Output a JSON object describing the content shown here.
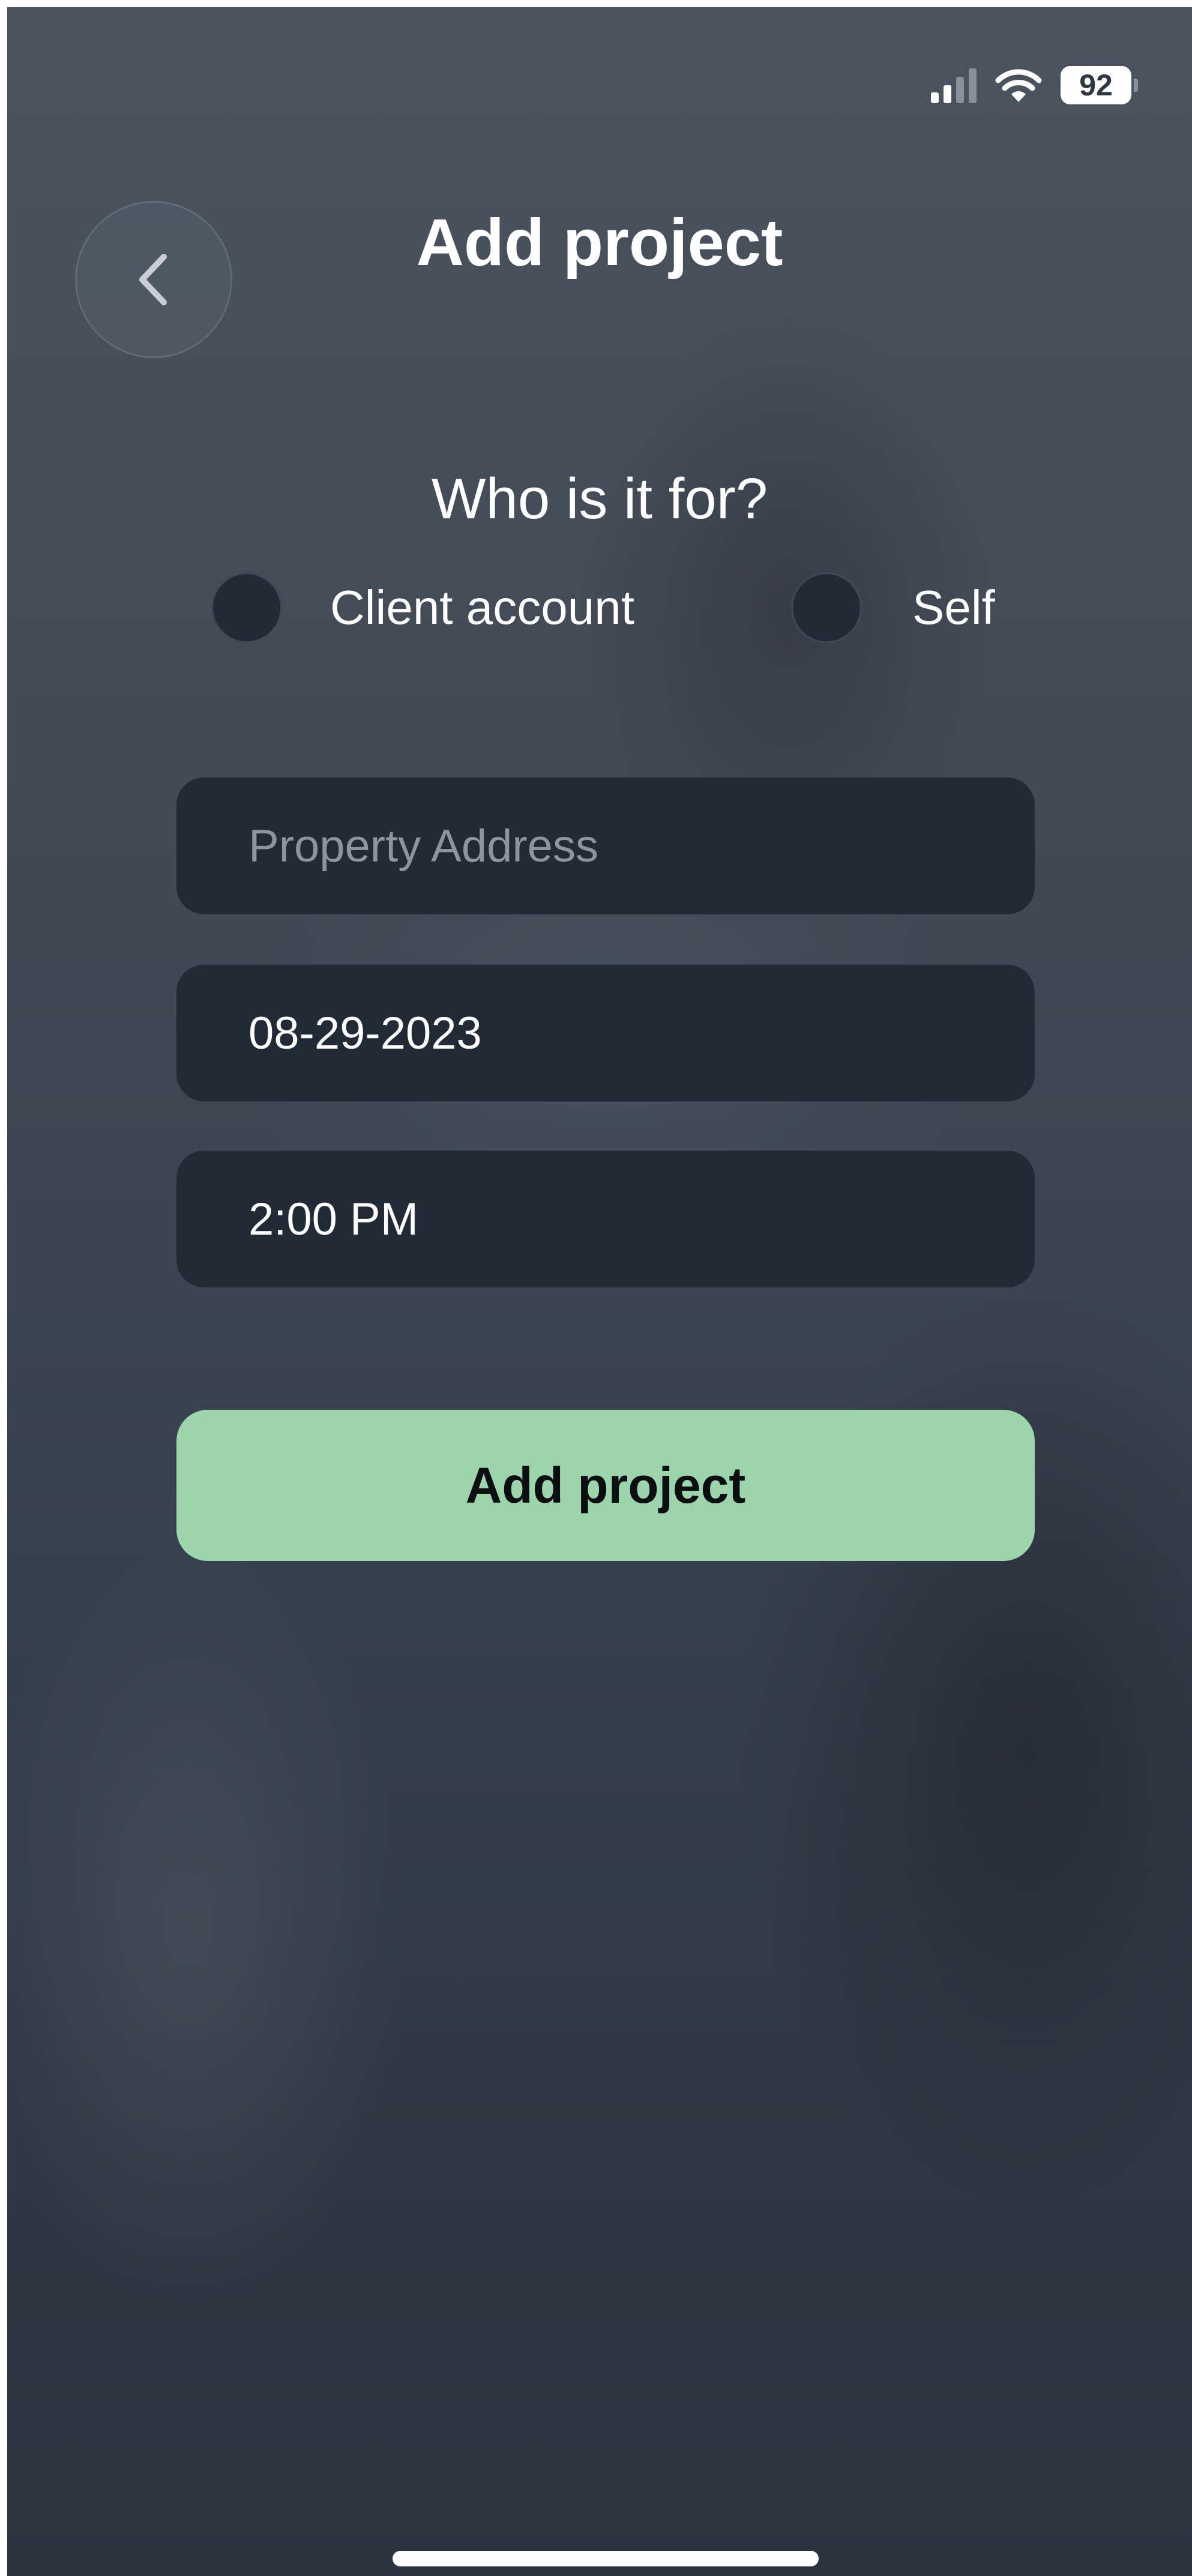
{
  "status_bar": {
    "battery_level": "92",
    "signal_bars_active": 2,
    "signal_bars_total": 4,
    "wifi_icon": "wifi-icon"
  },
  "header": {
    "back_icon": "chevron-left-icon",
    "title": "Add project"
  },
  "recipient": {
    "question": "Who is it for?",
    "options": [
      {
        "label": "Client account",
        "selected": false
      },
      {
        "label": "Self",
        "selected": false
      }
    ]
  },
  "form": {
    "address": {
      "placeholder": "Property Address",
      "value": ""
    },
    "date": {
      "value": "08-29-2023"
    },
    "time": {
      "value": "2:00 PM"
    }
  },
  "actions": {
    "submit_label": "Add project"
  },
  "colors": {
    "accent_button": "#9cd5ac",
    "field_background": "#222a36",
    "placeholder_text": "#8d949e"
  }
}
